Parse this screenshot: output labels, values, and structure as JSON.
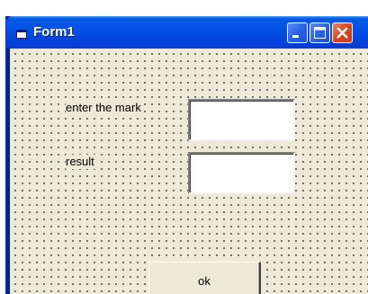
{
  "window": {
    "title": "Form1",
    "title_icon": "form-icon",
    "controls": [
      "minimize-icon",
      "maximize-icon",
      "close-icon"
    ]
  },
  "form": {
    "mark_label": "enter the mark",
    "mark_value": "",
    "result_label": "result",
    "result_value": "",
    "ok_label": "ok"
  },
  "colors": {
    "titlebar": "#0451e7",
    "client_background": "#ECE9D8",
    "close_button": "#d6471f"
  }
}
